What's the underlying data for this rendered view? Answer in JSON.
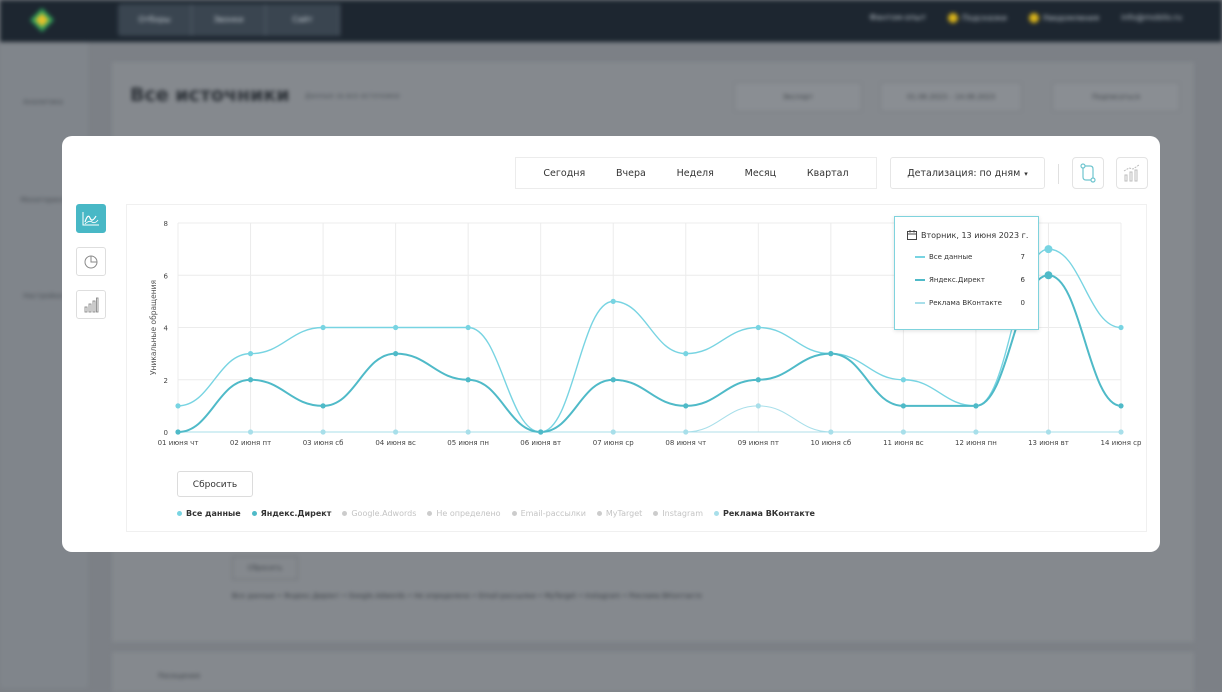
{
  "colors": {
    "accent": "#48b8c6",
    "series_all": "#78d4e2",
    "series_yandex": "#4fbac8",
    "series_vk": "#a8dfea",
    "series_flat": "#b0dfe8"
  },
  "background": {
    "topbar_tabs": [
      "Отборы",
      "Звонки",
      "Сайт"
    ],
    "topbar_right": [
      "Фантом-опыт",
      "Подсказки",
      "Уведомления",
      "info@mobilo.ru"
    ],
    "sidebar": [
      "Аналитика",
      "Мониторинг",
      "Настройки"
    ],
    "page_title": "Все источники",
    "page_subtitle": "Данные за все источники",
    "page_buttons": [
      "Экспорт",
      "01.06.2023 – 14.06.2023",
      "Подписаться"
    ],
    "reset": "Сбросить",
    "legend": "Все данные • Яндекс.Директ • Google.Adwords • Не определено • Email-рассылки • MyTarget • Instagram • Реклама ВКонтакте",
    "bottom": "Посещения"
  },
  "toolbar": {
    "periods": [
      "Сегодня",
      "Вчера",
      "Неделя",
      "Месяц",
      "Квартал"
    ],
    "detail": "Детализация: по дням",
    "caret": "▾"
  },
  "side_buttons": [
    "line-chart-icon",
    "pie-chart-icon",
    "bar-chart-icon"
  ],
  "reset_label": "Сбросить",
  "legend": [
    {
      "label": "Все данные",
      "active": true,
      "color": "#78d4e2"
    },
    {
      "label": "Яндекс.Директ",
      "active": true,
      "color": "#4fbac8"
    },
    {
      "label": "Google.Adwords",
      "active": false,
      "color": "#cccccc"
    },
    {
      "label": "Не определено",
      "active": false,
      "color": "#cccccc"
    },
    {
      "label": "Email-рассылки",
      "active": false,
      "color": "#cccccc"
    },
    {
      "label": "MyTarget",
      "active": false,
      "color": "#cccccc"
    },
    {
      "label": "Instagram",
      "active": false,
      "color": "#cccccc"
    },
    {
      "label": "Реклама ВКонтакте",
      "active": true,
      "color": "#a8dfea"
    }
  ],
  "tooltip": {
    "date": "Вторник, 13 июня 2023 г.",
    "rows": [
      {
        "label": "Все данные",
        "value": "7",
        "color": "#78d4e2"
      },
      {
        "label": "Яндекс.Директ",
        "value": "6",
        "color": "#4fbac8"
      },
      {
        "label": "Реклама ВКонтакте",
        "value": "0",
        "color": "#a8dfea"
      }
    ]
  },
  "chart_data": {
    "type": "line",
    "ylabel": "Уникальные обращения",
    "xlabel": "",
    "ylim": [
      0,
      8
    ],
    "yticks": [
      0,
      2,
      4,
      6,
      8
    ],
    "grid": true,
    "categories": [
      "01 июня чт",
      "02 июня пт",
      "03 июня сб",
      "04 июня вс",
      "05 июня пн",
      "06 июня вт",
      "07 июня ср",
      "08 июня чт",
      "09 июня пт",
      "10 июня сб",
      "11 июня вс",
      "12 июня пн",
      "13 июня вт",
      "14 июня ср"
    ],
    "series": [
      {
        "name": "Все данные",
        "values": [
          1,
          3,
          4,
          4,
          4,
          0,
          5,
          3,
          4,
          3,
          2,
          1,
          7,
          4
        ]
      },
      {
        "name": "Яндекс.Директ",
        "values": [
          0,
          2,
          1,
          3,
          2,
          0,
          2,
          1,
          2,
          3,
          1,
          1,
          6,
          1
        ]
      },
      {
        "name": "Реклама ВКонтакте",
        "values": [
          0,
          0,
          0,
          0,
          0,
          0,
          0,
          0,
          1,
          0,
          0,
          0,
          0,
          0
        ]
      }
    ]
  }
}
